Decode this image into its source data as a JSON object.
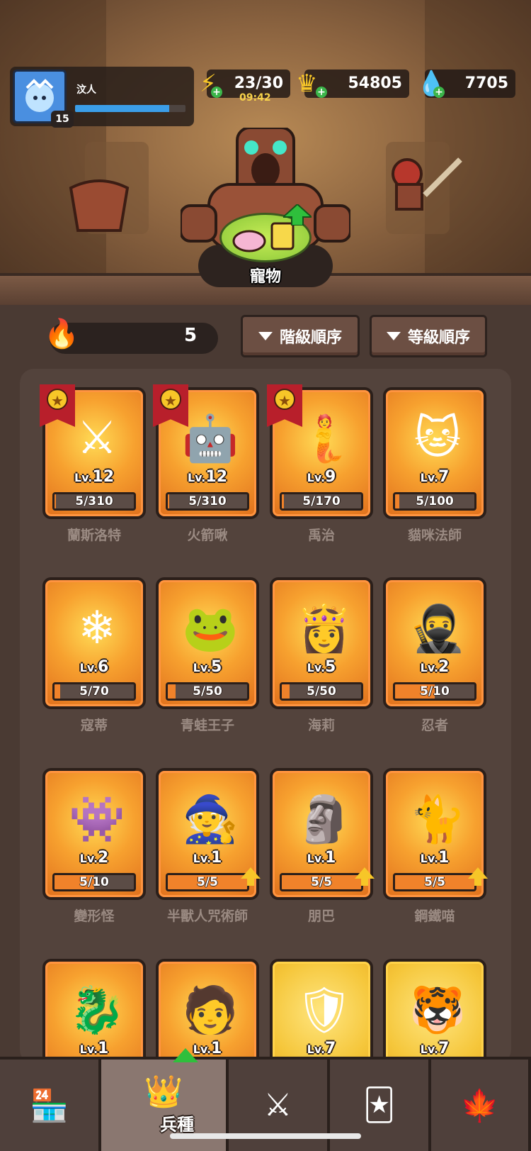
{
  "profile": {
    "name": "汶人",
    "level": "15",
    "xp_fraction": 0.85,
    "avatar_icon": "ice-spirit-avatar"
  },
  "resources": {
    "energy": {
      "value": "23/30",
      "timer": "09:42",
      "icon": "lightning-icon"
    },
    "gold": {
      "value": "54805",
      "icon": "crown-coin-icon"
    },
    "gems": {
      "value": "7705",
      "icon": "blue-gem-icon"
    }
  },
  "pet_banner": {
    "label": "寵物"
  },
  "toolbar": {
    "fire_count": "5",
    "sort_rank_label": "階級順序",
    "sort_level_label": "等級順序"
  },
  "heroes": [
    {
      "name": "蘭斯洛特",
      "lv": "12",
      "progress": "5/310",
      "fill": 0.02,
      "star": true,
      "upgrade": false,
      "gold": false,
      "icon": "⚔"
    },
    {
      "name": "火箭啾",
      "lv": "12",
      "progress": "5/310",
      "fill": 0.02,
      "star": true,
      "upgrade": false,
      "gold": false,
      "icon": "🤖"
    },
    {
      "name": "禹治",
      "lv": "9",
      "progress": "5/170",
      "fill": 0.03,
      "star": true,
      "upgrade": false,
      "gold": false,
      "icon": "🧜"
    },
    {
      "name": "貓咪法師",
      "lv": "7",
      "progress": "5/100",
      "fill": 0.05,
      "star": false,
      "upgrade": false,
      "gold": false,
      "icon": "🐱"
    },
    {
      "name": "寇蒂",
      "lv": "6",
      "progress": "5/70",
      "fill": 0.07,
      "star": false,
      "upgrade": false,
      "gold": false,
      "icon": "❄"
    },
    {
      "name": "青蛙王子",
      "lv": "5",
      "progress": "5/50",
      "fill": 0.1,
      "star": false,
      "upgrade": false,
      "gold": false,
      "icon": "🐸"
    },
    {
      "name": "海莉",
      "lv": "5",
      "progress": "5/50",
      "fill": 0.1,
      "star": false,
      "upgrade": false,
      "gold": false,
      "icon": "👸"
    },
    {
      "name": "忍者",
      "lv": "2",
      "progress": "5/10",
      "fill": 0.5,
      "star": false,
      "upgrade": false,
      "gold": false,
      "icon": "🥷"
    },
    {
      "name": "變形怪",
      "lv": "2",
      "progress": "5/10",
      "fill": 0.5,
      "star": false,
      "upgrade": false,
      "gold": false,
      "icon": "👾"
    },
    {
      "name": "半獸人咒術師",
      "lv": "1",
      "progress": "5/5",
      "fill": 1,
      "star": false,
      "upgrade": true,
      "gold": false,
      "icon": "🧙"
    },
    {
      "name": "朋巴",
      "lv": "1",
      "progress": "5/5",
      "fill": 1,
      "star": false,
      "upgrade": true,
      "gold": false,
      "icon": "🗿"
    },
    {
      "name": "鋼鐵喵",
      "lv": "1",
      "progress": "5/5",
      "fill": 1,
      "star": false,
      "upgrade": true,
      "gold": false,
      "icon": "🐈"
    },
    {
      "name": "",
      "lv": "1",
      "progress": "",
      "fill": 0,
      "star": false,
      "upgrade": false,
      "gold": false,
      "icon": "🐉"
    },
    {
      "name": "",
      "lv": "1",
      "progress": "",
      "fill": 0,
      "star": false,
      "upgrade": false,
      "gold": false,
      "icon": "🧑"
    },
    {
      "name": "",
      "lv": "7",
      "progress": "",
      "fill": 0,
      "star": false,
      "upgrade": false,
      "gold": true,
      "icon": "🛡"
    },
    {
      "name": "",
      "lv": "7",
      "progress": "",
      "fill": 0,
      "star": false,
      "upgrade": false,
      "gold": true,
      "icon": "🐯"
    }
  ],
  "nav": {
    "tabs": [
      {
        "id": "shop",
        "icon": "shop-icon",
        "glyph": "🏪"
      },
      {
        "id": "units",
        "icon": "crown-icon",
        "glyph": "👑",
        "label": "兵種"
      },
      {
        "id": "battle",
        "icon": "crossed-swords-icon",
        "glyph": "⚔"
      },
      {
        "id": "cards",
        "icon": "card-icon",
        "glyph": "🃏"
      },
      {
        "id": "guild",
        "icon": "guild-icon",
        "glyph": "🍁"
      }
    ]
  },
  "colors": {
    "accent_orange": "#f0822a",
    "star_red": "#b81f2b",
    "xp_blue": "#3b9ee8"
  }
}
